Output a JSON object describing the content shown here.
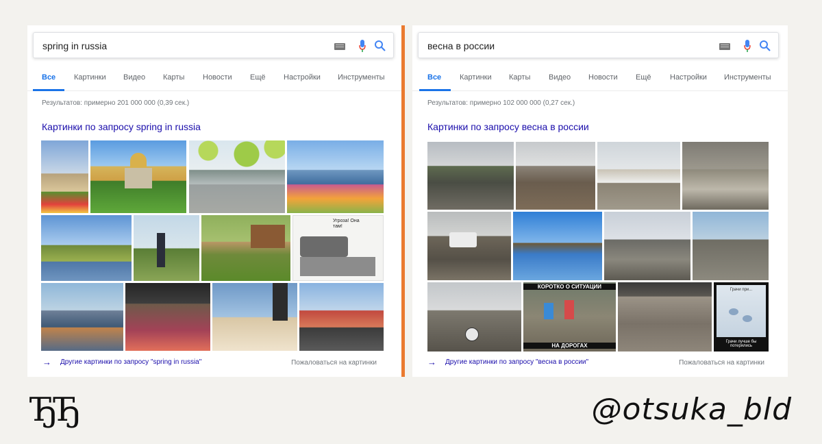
{
  "panels": [
    {
      "query": "spring in russia",
      "tabs": [
        "Все",
        "Картинки",
        "Видео",
        "Карты",
        "Новости",
        "Ещё",
        "Настройки",
        "Инструменты"
      ],
      "stats": "Результатов: примерно 201 000 000 (0,39 сек.)",
      "section_title": "Картинки по запросу spring in russia",
      "more_link": "Другие картинки по запросу \"spring in russia\"",
      "report_link": "Пожаловаться на картинки"
    },
    {
      "query": "весна в россии",
      "tabs": [
        "Все",
        "Картинки",
        "Карты",
        "Видео",
        "Новости",
        "Ещё",
        "Настройки",
        "Инструменты"
      ],
      "stats": "Результатов: примерно 102 000 000 (0,27 сек.)",
      "section_title": "Картинки по запросу весна в россии",
      "more_link": "Другие картинки по запросу \"весна в россии\"",
      "report_link": "Пожаловаться на картинки",
      "image_captions": {
        "situation": "КОРОТКО О СИТУАЦИИ",
        "roads": "НА ДОРОГАХ",
        "rooks_top": "Грачи при...",
        "rooks_bottom": "Грачи лучше бы потерялись"
      }
    }
  ],
  "comic_bubble": "Угроза! Она там!",
  "footer": {
    "logo": "ЂЂ",
    "handle": "@otsuka_bld"
  },
  "colors": {
    "divider": "#ea7a2f",
    "link": "#1a0dab",
    "active_tab": "#1a73e8",
    "page_bg": "#f3f2ee"
  }
}
